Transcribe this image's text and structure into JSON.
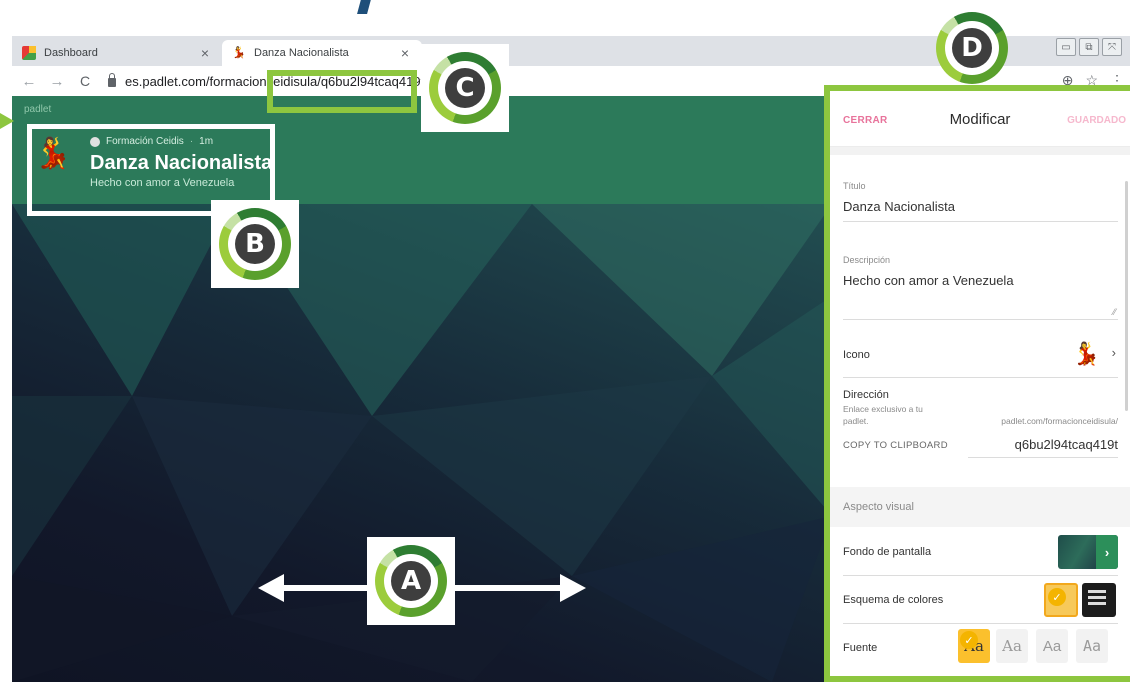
{
  "browser": {
    "tabs": [
      {
        "label": "Dashboard",
        "close": "×"
      },
      {
        "label": "Danza Nacionalista",
        "close": "×"
      }
    ],
    "url": "es.padlet.com/formacionceidisula/q6bu2l94tcaq419t",
    "nav": {
      "back": "←",
      "forward": "→",
      "reload": "C"
    },
    "window_controls": [
      "▭",
      "⧉",
      "⤧"
    ],
    "toolbar_icons": [
      "⊕",
      "☆",
      "⋮"
    ]
  },
  "padlet": {
    "brand": "padlet",
    "author": "Formación Ceidis",
    "time": "1m",
    "title": "Danza Nacionalista",
    "description": "Hecho con amor a Venezuela",
    "icon": "💃"
  },
  "annotations": {
    "a": "A",
    "b": "B",
    "c": "C",
    "d": "D"
  },
  "panel": {
    "close": "CERRAR",
    "title": "Modificar",
    "saved": "GUARDADO",
    "title_label": "Título",
    "title_value": "Danza Nacionalista",
    "desc_label": "Descripción",
    "desc_value": "Hecho con amor a Venezuela",
    "icon_label": "Icono",
    "icon_value": "💃",
    "address_label": "Dirección",
    "address_hint_1": "Enlace exclusivo a tu",
    "address_hint_2": "padlet.",
    "address_prefix": "padlet.com/formacionceidisula/",
    "copy_label": "COPY TO CLIPBOARD",
    "address_slug": "q6bu2l94tcaq419t",
    "section_title": "Aspecto visual",
    "wallpaper_label": "Fondo de pantalla",
    "colors_label": "Esquema de colores",
    "font_label": "Fuente",
    "font_samples": [
      "Aa",
      "Aa",
      "Aa",
      "Aa"
    ],
    "chevron": "›",
    "check": "✓"
  }
}
